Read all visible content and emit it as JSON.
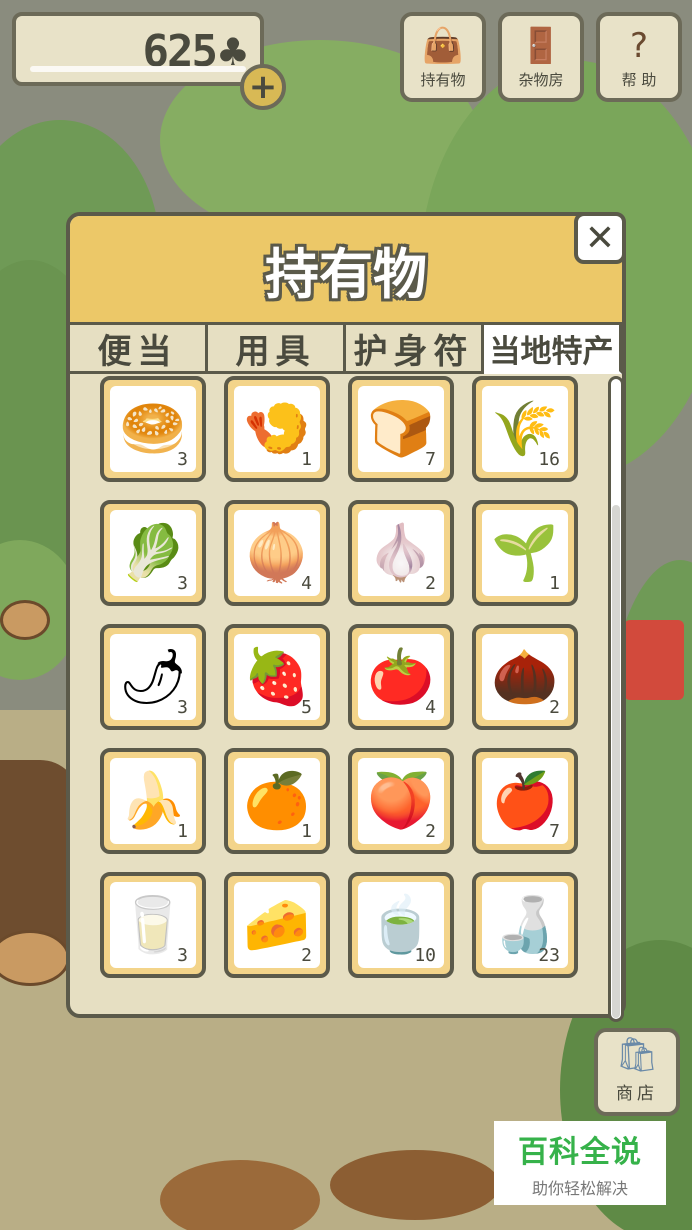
{
  "currency": {
    "count": "625",
    "icon": "clover-icon",
    "add_label": "+"
  },
  "top_buttons": [
    {
      "name": "inventory",
      "label": "持有物",
      "icon": "bag-icon"
    },
    {
      "name": "storeroom",
      "label": "杂物房",
      "icon": "door-icon"
    },
    {
      "name": "help",
      "label": "帮 助",
      "icon": "question-icon"
    }
  ],
  "modal": {
    "title": "持有物",
    "close_label": "✕",
    "tabs": [
      "便当",
      "用具",
      "护身符",
      "当地特产"
    ],
    "active_tab": 3,
    "items": [
      {
        "name": "buns",
        "icon": "🥯",
        "qty": "3"
      },
      {
        "name": "tempura",
        "icon": "🍤",
        "qty": "1"
      },
      {
        "name": "manju",
        "icon": "🍞",
        "qty": "7"
      },
      {
        "name": "rice-sack",
        "icon": "🌾",
        "qty": "16"
      },
      {
        "name": "cabbage",
        "icon": "🥬",
        "qty": "3"
      },
      {
        "name": "onion",
        "icon": "🧅",
        "qty": "4"
      },
      {
        "name": "garlic",
        "icon": "🧄",
        "qty": "2"
      },
      {
        "name": "green-onion",
        "icon": "🌱",
        "qty": "1"
      },
      {
        "name": "chili-pepper",
        "icon": "🌶",
        "qty": "3"
      },
      {
        "name": "strawberry",
        "icon": "🍓",
        "qty": "5"
      },
      {
        "name": "persimmon",
        "icon": "🍅",
        "qty": "4"
      },
      {
        "name": "chestnut",
        "icon": "🌰",
        "qty": "2"
      },
      {
        "name": "banana",
        "icon": "🍌",
        "qty": "1"
      },
      {
        "name": "mandarin",
        "icon": "🍊",
        "qty": "1"
      },
      {
        "name": "peach",
        "icon": "🍑",
        "qty": "2"
      },
      {
        "name": "apple",
        "icon": "🍎",
        "qty": "7"
      },
      {
        "name": "milk",
        "icon": "🥛",
        "qty": "3"
      },
      {
        "name": "cheese",
        "icon": "🧀",
        "qty": "2"
      },
      {
        "name": "tea-can",
        "icon": "🍵",
        "qty": "10"
      },
      {
        "name": "bottle",
        "icon": "🍶",
        "qty": "23"
      }
    ]
  },
  "shop": {
    "label": "商店",
    "icon": "shop-bag-icon"
  },
  "watermark": {
    "title": "百科全说",
    "subtitle": "助你轻松解决"
  }
}
